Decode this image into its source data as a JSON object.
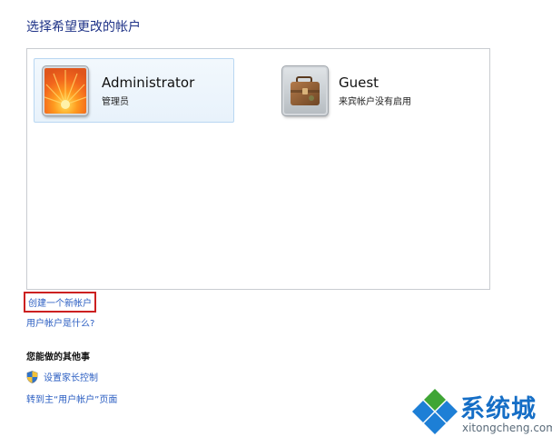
{
  "heading": "选择希望更改的帐户",
  "accounts": [
    {
      "name": "Administrator",
      "role": "管理员",
      "icon": "flower-avatar-icon",
      "selected": true
    },
    {
      "name": "Guest",
      "role": "来宾帐户没有启用",
      "icon": "briefcase-avatar-icon",
      "selected": false
    }
  ],
  "links": {
    "create_account": "创建一个新帐户",
    "what_is": "用户帐户是什么?"
  },
  "other": {
    "title": "您能做的其他事",
    "parental_controls": "设置家长控制",
    "main_page": "转到主“用户帐户”页面"
  },
  "watermark": {
    "name": "系统城",
    "url": "xitongcheng.com"
  },
  "colors": {
    "link": "#2b5ec2",
    "heading": "#1e3287",
    "highlight_border": "#cc2020"
  }
}
